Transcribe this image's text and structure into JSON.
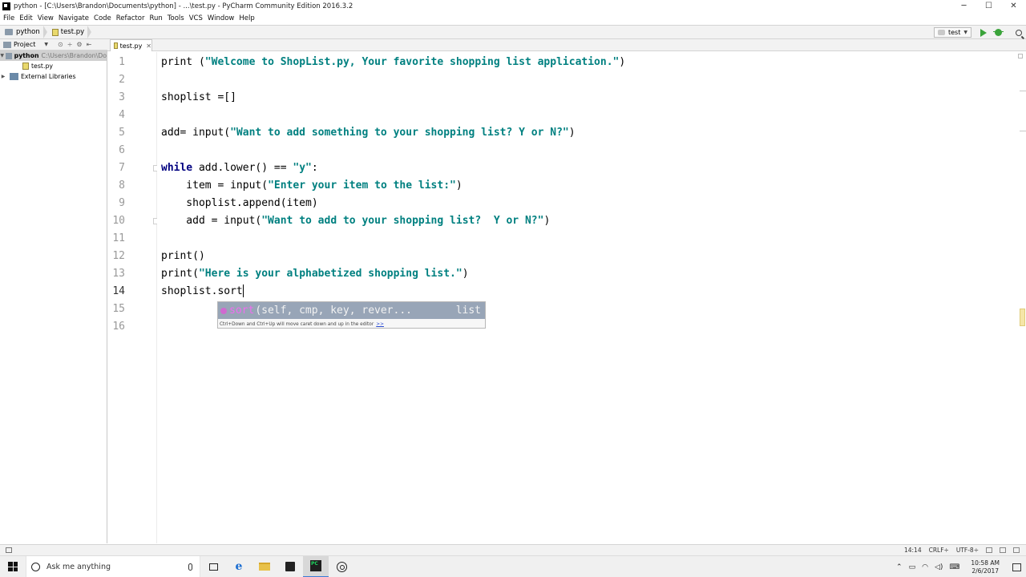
{
  "window": {
    "title": "python - [C:\\Users\\Brandon\\Documents\\python] - ...\\test.py - PyCharm Community Edition 2016.3.2",
    "min": "─",
    "max": "☐",
    "close": "✕"
  },
  "menu": [
    "File",
    "Edit",
    "View",
    "Navigate",
    "Code",
    "Refactor",
    "Run",
    "Tools",
    "VCS",
    "Window",
    "Help"
  ],
  "nav": {
    "crumb_project": "python",
    "crumb_file": "test.py",
    "run_config": "test"
  },
  "project_panel": {
    "header": "Project",
    "tree": [
      {
        "label": "python",
        "path": "C:\\Users\\Brandon\\Do"
      },
      {
        "label": "test.py"
      },
      {
        "label": "External Libraries"
      }
    ]
  },
  "editor": {
    "tab": "test.py",
    "lines": [
      {
        "num": "1",
        "parts": [
          {
            "t": "print",
            "c": "plain"
          },
          {
            "t": " (",
            "c": "plain"
          },
          {
            "t": "\"Welcome to ShopList.py, Your favorite shopping list application.\"",
            "c": "str"
          },
          {
            "t": ")",
            "c": "plain"
          }
        ]
      },
      {
        "num": "2",
        "parts": []
      },
      {
        "num": "3",
        "parts": [
          {
            "t": "shoplist =[]",
            "c": "plain"
          }
        ]
      },
      {
        "num": "4",
        "parts": []
      },
      {
        "num": "5",
        "parts": [
          {
            "t": "add= input(",
            "c": "plain"
          },
          {
            "t": "\"Want to add something to your shopping list? Y or N?\"",
            "c": "str"
          },
          {
            "t": ")",
            "c": "plain"
          }
        ]
      },
      {
        "num": "6",
        "parts": []
      },
      {
        "num": "7",
        "parts": [
          {
            "t": "while",
            "c": "kw"
          },
          {
            "t": " add.lower() == ",
            "c": "plain"
          },
          {
            "t": "\"y\"",
            "c": "str"
          },
          {
            "t": ":",
            "c": "plain"
          }
        ]
      },
      {
        "num": "8",
        "parts": [
          {
            "t": "    item = input(",
            "c": "plain"
          },
          {
            "t": "\"Enter your item to the list:\"",
            "c": "str"
          },
          {
            "t": ")",
            "c": "plain"
          }
        ]
      },
      {
        "num": "9",
        "parts": [
          {
            "t": "    shoplist.append(item)",
            "c": "plain"
          }
        ]
      },
      {
        "num": "10",
        "parts": [
          {
            "t": "    add = input(",
            "c": "plain"
          },
          {
            "t": "\"Want to add to your shopping list?  Y or N?\"",
            "c": "str"
          },
          {
            "t": ")",
            "c": "plain"
          }
        ]
      },
      {
        "num": "11",
        "parts": []
      },
      {
        "num": "12",
        "parts": [
          {
            "t": "print()",
            "c": "plain"
          }
        ]
      },
      {
        "num": "13",
        "parts": [
          {
            "t": "print(",
            "c": "plain"
          },
          {
            "t": "\"Here is your alphabetized shopping list.\"",
            "c": "str"
          },
          {
            "t": ")",
            "c": "plain"
          }
        ]
      },
      {
        "num": "14",
        "parts": [
          {
            "t": "shoplist.sort",
            "c": "plain"
          }
        ]
      },
      {
        "num": "15",
        "parts": []
      },
      {
        "num": "16",
        "parts": []
      }
    ]
  },
  "completion": {
    "name": "sort",
    "signature": "(self, cmp, key, rever...",
    "type": "list",
    "hint": "Ctrl+Down and Ctrl+Up will move caret down and up in the editor",
    "more": ">>"
  },
  "status": {
    "position": "14:14",
    "line_sep": "CRLF÷",
    "encoding": "UTF-8÷"
  },
  "taskbar": {
    "search_placeholder": "Ask me anything",
    "time": "10:58 AM",
    "date": "2/6/2017"
  }
}
